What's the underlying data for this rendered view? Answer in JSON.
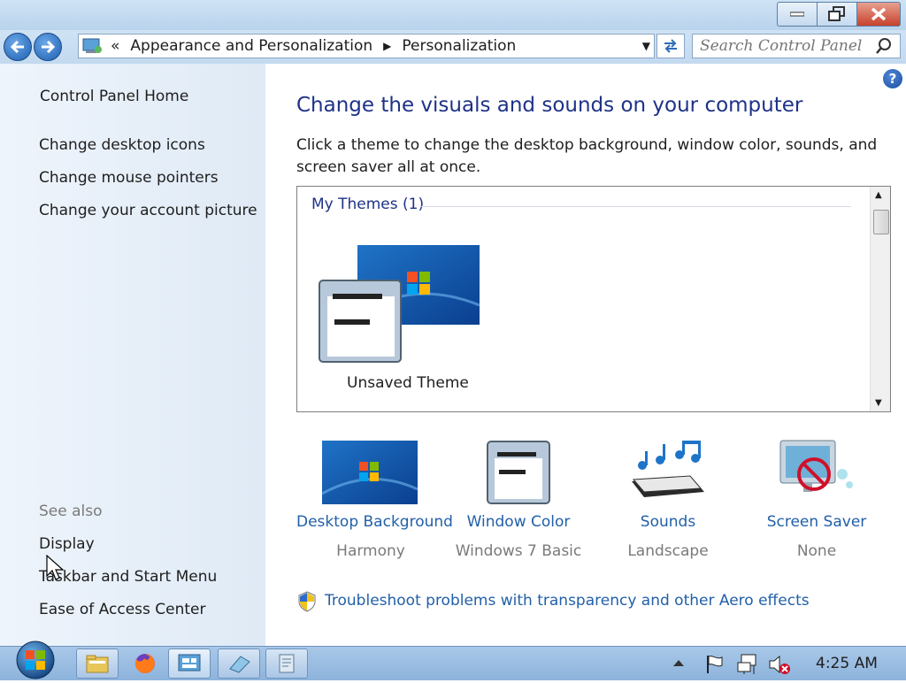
{
  "window": {
    "buttons": {
      "minimize": "minimize",
      "maximize": "restore",
      "close": "close"
    }
  },
  "address": {
    "sep": "«",
    "crumbs": [
      "Appearance and Personalization",
      "Personalization"
    ]
  },
  "search": {
    "placeholder": "Search Control Panel"
  },
  "sidebar": {
    "home": "Control Panel Home",
    "tasks": [
      "Change desktop icons",
      "Change mouse pointers",
      "Change your account picture"
    ],
    "see_also_title": "See also",
    "see_also": [
      "Display",
      "Taskbar and Start Menu",
      "Ease of Access Center"
    ]
  },
  "main": {
    "heading": "Change the visuals and sounds on your computer",
    "description": "Click a theme to change the desktop background, window color, sounds, and screen saver all at once.",
    "themes_group": "My Themes (1)",
    "theme_name": "Unsaved Theme",
    "settings": [
      {
        "label": "Desktop Background",
        "value": "Harmony"
      },
      {
        "label": "Window Color",
        "value": "Windows 7 Basic"
      },
      {
        "label": "Sounds",
        "value": "Landscape"
      },
      {
        "label": "Screen Saver",
        "value": "None"
      }
    ],
    "troubleshoot": "Troubleshoot problems with transparency and other Aero effects"
  },
  "taskbar": {
    "clock": "4:25 AM"
  },
  "colors": {
    "link": "#2260a8",
    "heading": "#1e3287",
    "sidebar": "#e6eef8"
  }
}
